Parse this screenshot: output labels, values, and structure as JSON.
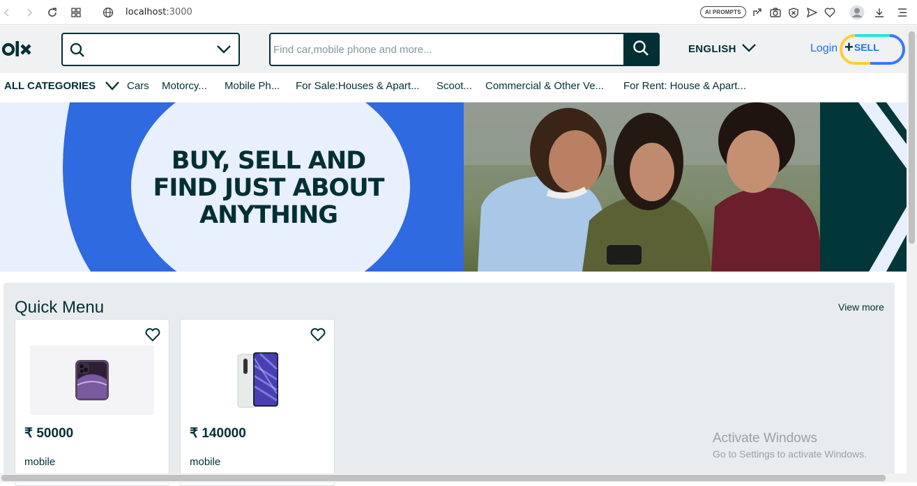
{
  "browser": {
    "url_host": "localhost",
    "url_port": ":3000",
    "ai_prompts_label": "AI PROMPTS",
    "icons": [
      "back-icon",
      "forward-icon",
      "reload-icon",
      "apps-icon",
      "site-info-icon",
      "share-icon",
      "camera-icon",
      "shield-icon",
      "send-icon",
      "heart-icon",
      "profile-icon",
      "download-icon",
      "menu-icon"
    ]
  },
  "header": {
    "logo_text": "OLX",
    "search_placeholder": "Find car,mobile phone and more...",
    "search_value": "",
    "language": "ENGLISH",
    "login_label": "Login",
    "sell_label": "SELL",
    "brand_color": "#002f34",
    "accent_color": "#1a73e8"
  },
  "categories": {
    "all_label": "ALL CATEGORIES",
    "items": [
      "Cars",
      "Motorcy...",
      "Mobile Ph...",
      "For Sale:Houses & Apart...",
      "Scoot...",
      "Commercial & Other Ve...",
      "For Rent: House & Apart..."
    ]
  },
  "hero": {
    "title_line1": "BUY, SELL AND",
    "title_line2": "FIND JUST ABOUT",
    "title_line3": "ANYTHING"
  },
  "quick_menu": {
    "title": "Quick Menu",
    "view_more": "View more",
    "products": [
      {
        "price": "₹ 50000",
        "title": "mobile",
        "image": "iphone-image"
      },
      {
        "price": "₹ 140000",
        "title": "mobile",
        "image": "android-phone-image"
      }
    ]
  },
  "watermark": {
    "line1": "Activate Windows",
    "line2": "Go to Settings to activate Windows."
  }
}
